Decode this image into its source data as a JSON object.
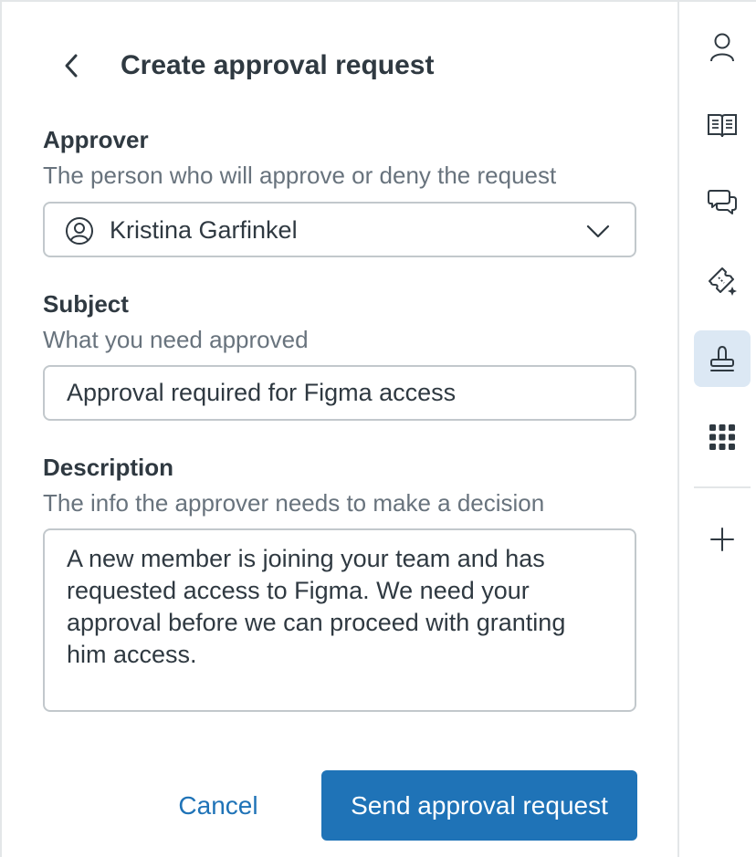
{
  "header": {
    "title": "Create approval request"
  },
  "approver": {
    "label": "Approver",
    "hint": "The person who will approve or deny the request",
    "selected": "Kristina Garfinkel"
  },
  "subject": {
    "label": "Subject",
    "hint": "What you need approved",
    "value": "Approval required for Figma access"
  },
  "description": {
    "label": "Description",
    "hint": "The info the approver needs to make a decision",
    "value": "A new member is joining your team and has requested access to Figma. We need your approval before we can proceed with granting him access."
  },
  "actions": {
    "cancel_label": "Cancel",
    "send_label": "Send approval request"
  },
  "rail": {
    "items": [
      {
        "icon": "user-icon"
      },
      {
        "icon": "book-icon"
      },
      {
        "icon": "chat-icon"
      },
      {
        "icon": "ticket-sparkle-icon"
      },
      {
        "icon": "stamp-icon",
        "active": true
      },
      {
        "icon": "apps-grid-icon"
      },
      {
        "icon": "plus-icon"
      }
    ]
  },
  "colors": {
    "primary": "#1f73b7",
    "active_bg": "#dce8f4",
    "text": "#2f3941",
    "hint": "#68737d",
    "border": "#c2c8cc"
  }
}
